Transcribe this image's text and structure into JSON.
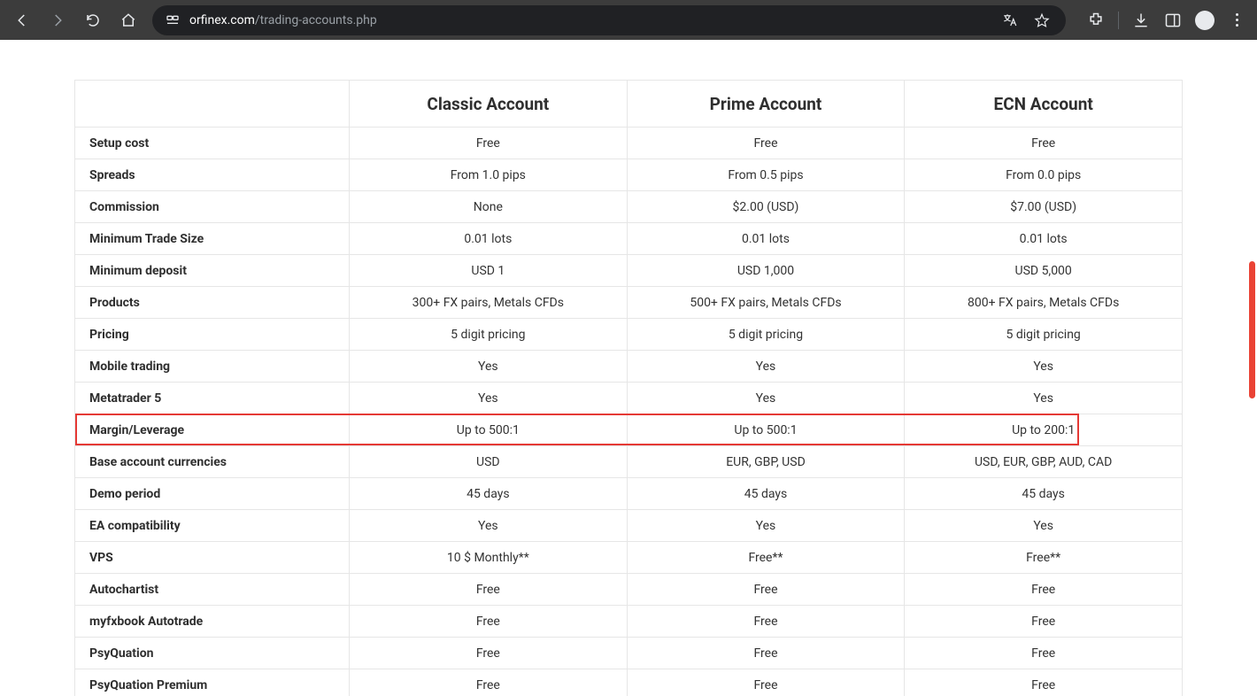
{
  "browser": {
    "url_domain": "orfinex.com",
    "url_path": "/trading-accounts.php"
  },
  "table": {
    "headers": [
      "",
      "Classic Account",
      "Prime Account",
      "ECN Account"
    ],
    "rows": [
      {
        "label": "Setup cost",
        "v": [
          "Free",
          "Free",
          "Free"
        ]
      },
      {
        "label": "Spreads",
        "v": [
          "From 1.0 pips",
          "From 0.5 pips",
          "From 0.0 pips"
        ]
      },
      {
        "label": "Commission",
        "v": [
          "None",
          "$2.00 (USD)",
          "$7.00 (USD)"
        ]
      },
      {
        "label": "Minimum Trade Size",
        "v": [
          "0.01 lots",
          "0.01 lots",
          "0.01 lots"
        ]
      },
      {
        "label": "Minimum deposit",
        "v": [
          "USD 1",
          "USD 1,000",
          "USD 5,000"
        ]
      },
      {
        "label": "Products",
        "v": [
          "300+ FX pairs, Metals CFDs",
          "500+ FX pairs, Metals CFDs",
          "800+ FX pairs, Metals CFDs"
        ]
      },
      {
        "label": "Pricing",
        "v": [
          "5 digit pricing",
          "5 digit pricing",
          "5 digit pricing"
        ]
      },
      {
        "label": "Mobile trading",
        "v": [
          "Yes",
          "Yes",
          "Yes"
        ]
      },
      {
        "label": "Metatrader 5",
        "v": [
          "Yes",
          "Yes",
          "Yes"
        ]
      },
      {
        "label": "Margin/Leverage",
        "v": [
          "Up to 500:1",
          "Up to 500:1",
          "Up to 200:1"
        ],
        "highlight": true
      },
      {
        "label": "Base account currencies",
        "v": [
          "USD",
          "EUR, GBP, USD",
          "USD, EUR, GBP, AUD, CAD"
        ]
      },
      {
        "label": "Demo period",
        "v": [
          "45 days",
          "45 days",
          "45 days"
        ]
      },
      {
        "label": "EA compatibility",
        "v": [
          "Yes",
          "Yes",
          "Yes"
        ]
      },
      {
        "label": "VPS",
        "v": [
          "10 $ Monthly**",
          "Free**",
          "Free**"
        ]
      },
      {
        "label": "Autochartist",
        "v": [
          "Free",
          "Free",
          "Free"
        ]
      },
      {
        "label": "myfxbook Autotrade",
        "v": [
          "Free",
          "Free",
          "Free"
        ]
      },
      {
        "label": "PsyQuation",
        "v": [
          "Free",
          "Free",
          "Free"
        ]
      },
      {
        "label": "PsyQuation Premium",
        "v": [
          "Free",
          "Free",
          "Free"
        ]
      }
    ]
  }
}
